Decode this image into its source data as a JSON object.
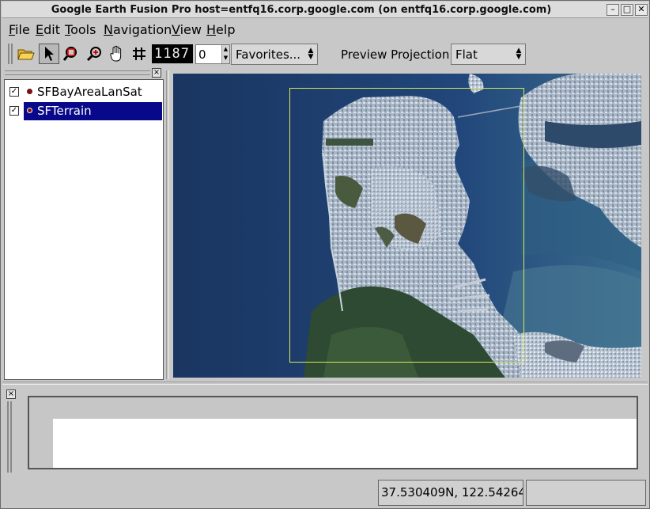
{
  "window": {
    "title": "Google Earth Fusion Pro  host=entfq16.corp.google.com (on entfq16.corp.google.com)",
    "minimize": "–",
    "maximize": "□",
    "close": "✕"
  },
  "menubar": [
    {
      "label": "File"
    },
    {
      "label": "Edit"
    },
    {
      "label": "Tools"
    },
    {
      "label": "Navigation"
    },
    {
      "label": "View"
    },
    {
      "label": "Help"
    }
  ],
  "toolbar": {
    "tools": [
      "open-folder-icon",
      "arrow-select-icon",
      "zoom-box-icon",
      "zoom-icon",
      "pan-hand-icon",
      "grid-icon"
    ],
    "level_display": "1187",
    "spin_value": "0",
    "favorites": "Favorites...",
    "projection_label": "Preview Projection:",
    "projection_value": "Flat"
  },
  "layers": {
    "close": "×",
    "items": [
      {
        "name": "SFBayAreaLanSat",
        "checked": true,
        "selected": false
      },
      {
        "name": "SFTerrain",
        "checked": true,
        "selected": true
      }
    ]
  },
  "bottom_panel": {
    "close": "×"
  },
  "status": {
    "coordinates": "37.530409N, 122.54264",
    "extra": ""
  },
  "colors": {
    "selection": "#08088a",
    "bbox": "#d8e85a",
    "water": "#1c3b68"
  }
}
